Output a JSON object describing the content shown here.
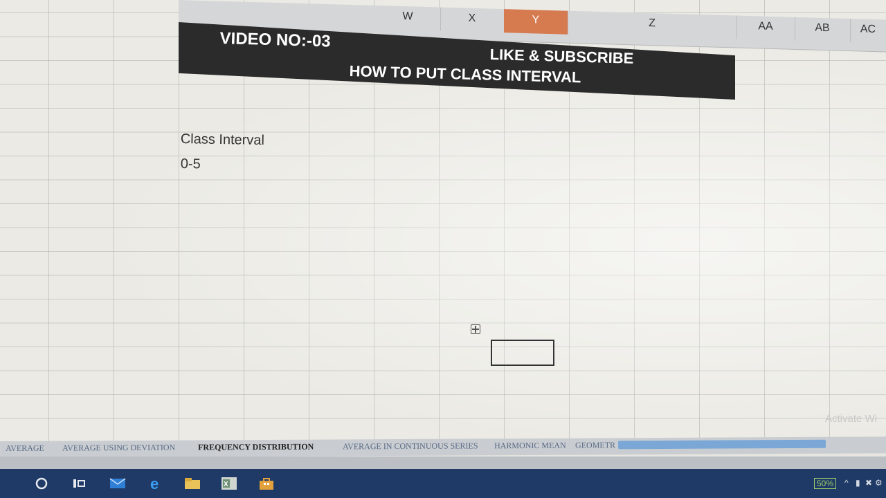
{
  "columns": {
    "w": "W",
    "x": "X",
    "y": "Y",
    "z": "Z",
    "aa": "AA",
    "ab": "AB",
    "ac": "AC"
  },
  "banner": {
    "video_no": "VIDEO NO:-03",
    "like_subscribe": "LIKE & SUBSCRIBE",
    "title": "HOW TO PUT CLASS INTERVAL"
  },
  "cells": {
    "header": "Class Interval",
    "first_value": "0-5"
  },
  "sheet_tabs": [
    {
      "label": "AVERAGE"
    },
    {
      "label": "AVERAGE USING DEVIATION"
    },
    {
      "label": "FREQUENCY DISTRIBUTION"
    },
    {
      "label": "AVERAGE IN CONTINUOUS SERIES"
    },
    {
      "label": "HARMONIC MEAN"
    },
    {
      "label": "GEOMETR"
    }
  ],
  "active_tab": "FREQUENCY DISTRIBUTION",
  "watermark": "Activate Wi",
  "tray": {
    "battery": "50%"
  },
  "colors": {
    "selected_column": "#d67a50",
    "banner_bg": "#2b2b2b",
    "taskbar": "#1f3a66"
  },
  "icons": [
    "search-circle-icon",
    "task-view-icon",
    "mail-icon",
    "edge-icon",
    "file-explorer-icon",
    "excel-icon",
    "store-icon"
  ]
}
